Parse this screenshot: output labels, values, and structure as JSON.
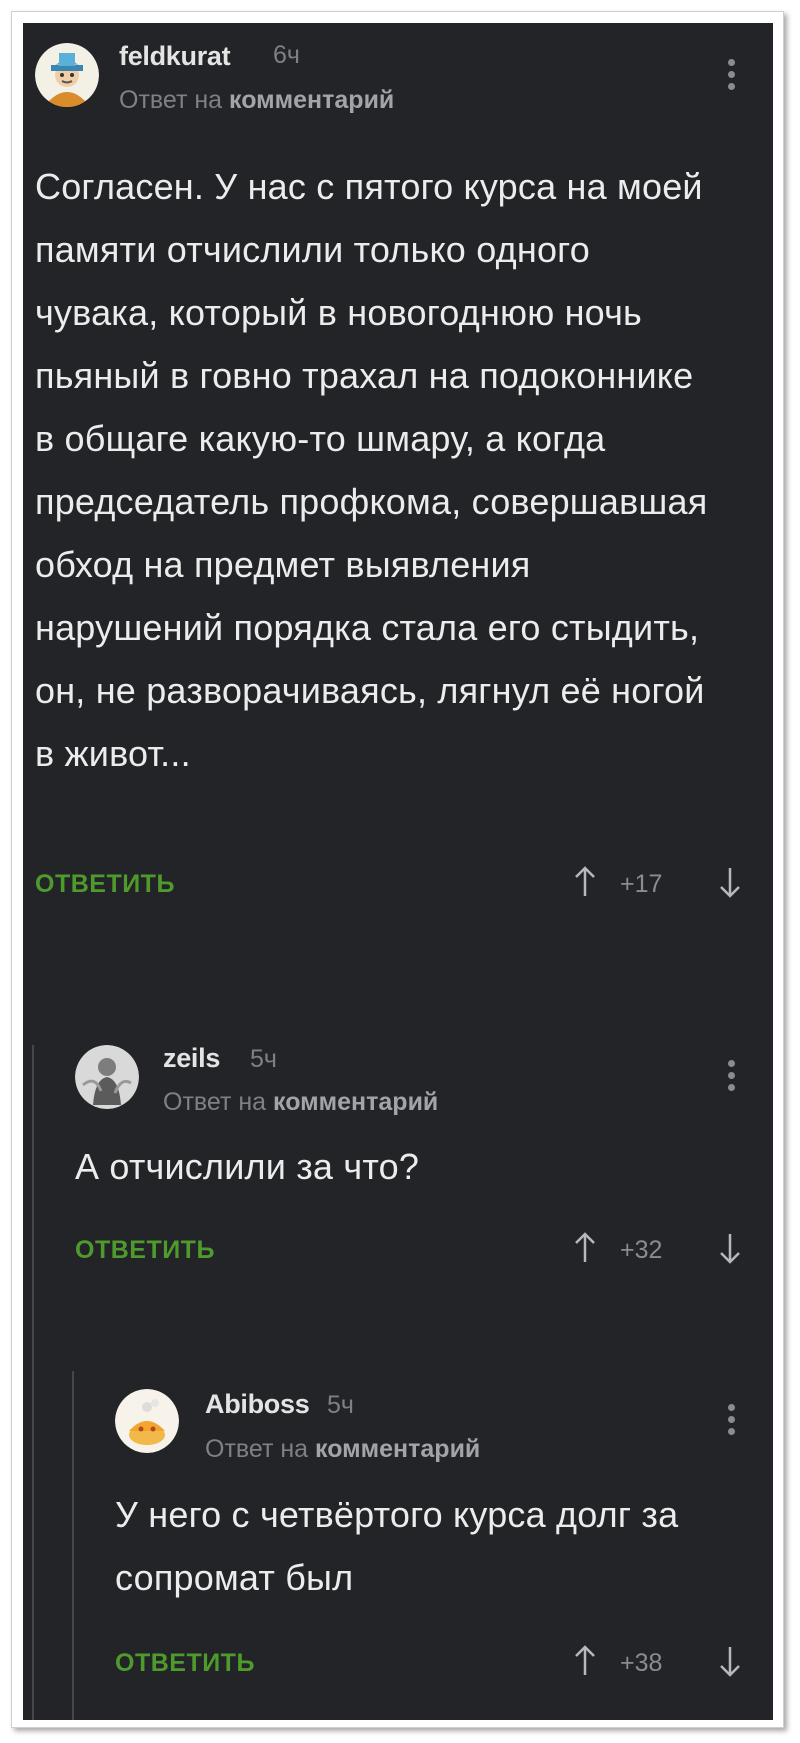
{
  "comments": [
    {
      "username": "feldkurat",
      "time": "6ч",
      "reply_prefix": "Ответ на ",
      "reply_link": "комментарий",
      "text": "Согласен. У нас с пятого курса на моей памяти отчислили только одного чувака, который в новогоднюю ночь пьяный в говно трахал на подоконнике в общаге какую-то шмару, а когда председатель профкома, совершавшая обход на предмет выявления нарушений порядка стала его стыдить, он, не разворачиваясь, лягнул её ногой в живот...",
      "reply_label": "ОТВЕТИТЬ",
      "score": "+17"
    },
    {
      "username": "zeils",
      "time": "5ч",
      "reply_prefix": "Ответ на ",
      "reply_link": "комментарий",
      "text": "А отчислили за что?",
      "reply_label": "ОТВЕТИТЬ",
      "score": "+32"
    },
    {
      "username": "Abiboss",
      "time": "5ч",
      "reply_prefix": "Ответ на ",
      "reply_link": "комментарий",
      "text": "У него с четвёртого курса долг за сопромат был",
      "reply_label": "ОТВЕТИТЬ",
      "score": "+38"
    }
  ],
  "colors": {
    "background": "#222427",
    "text": "#ececec",
    "meta": "#7e8083",
    "reply_accent": "#4f9a2c"
  },
  "icons": [
    "avatar-cartoon",
    "avatar-photo",
    "avatar-emoji",
    "more-vertical-icon",
    "arrow-up-icon",
    "arrow-down-icon"
  ]
}
